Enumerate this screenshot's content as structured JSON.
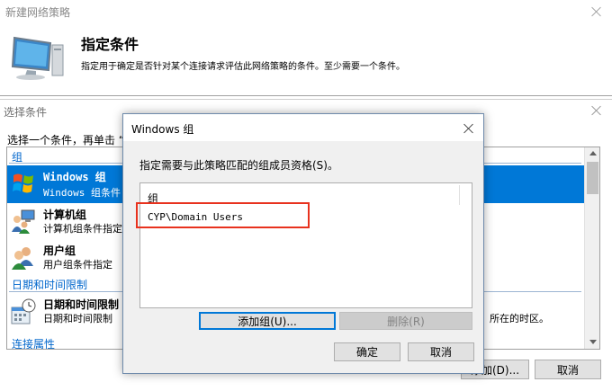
{
  "wizard": {
    "window_title": "新建网络策略",
    "heading": "指定条件",
    "description": "指定用于确定是否针对某个连接请求评估此网络策略的条件。至少需要一个条件。"
  },
  "select_condition": {
    "title": "选择条件",
    "instruction": "选择一个条件，再单击 “",
    "groups": [
      {
        "header": "组",
        "items": [
          {
            "title": "Windows 组",
            "desc": "Windows 组条件",
            "selected": true,
            "icon": "windows-group-icon"
          },
          {
            "title": "计算机组",
            "desc": "计算机组条件指定",
            "selected": false,
            "icon": "computer-group-icon"
          },
          {
            "title": "用户组",
            "desc": "用户组条件指定",
            "selected": false,
            "icon": "user-group-icon"
          }
        ]
      },
      {
        "header": "日期和时间限制",
        "items": [
          {
            "title": "日期和时间限制",
            "desc": "日期和时间限制",
            "desc_tail": "所在的时区。",
            "selected": false,
            "icon": "calendar-clock-icon"
          }
        ]
      },
      {
        "header": "连接属性",
        "items": []
      }
    ],
    "add_button": "添加(D)...",
    "cancel_button": "取消"
  },
  "windows_group_dialog": {
    "title": "Windows 组",
    "instruction": "指定需要与此策略匹配的组成员资格(S)。",
    "list_header": "组",
    "groups": [
      "CYP\\Domain Users"
    ],
    "add_group_button": "添加组(U)...",
    "remove_button": "删除(R)",
    "ok_button": "确定",
    "cancel_button": "取消"
  },
  "colors": {
    "selection": "#0078d7",
    "link_blue": "#0066cc",
    "highlight_box": "#e8321e"
  }
}
